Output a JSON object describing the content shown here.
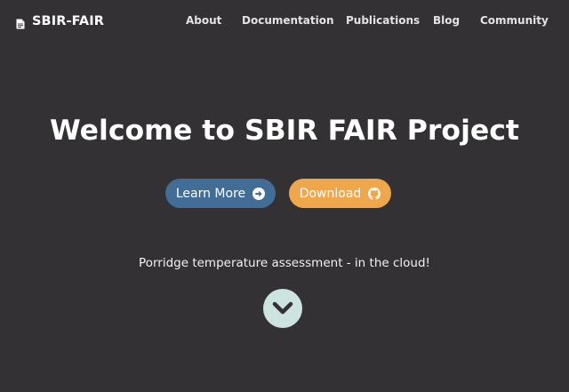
{
  "navbar": {
    "brand": {
      "label": "SBIR-FAIR",
      "icon": "document-icon"
    },
    "links": [
      {
        "label": "About"
      },
      {
        "label": "Documentation"
      },
      {
        "label": "Publications"
      },
      {
        "label": "Blog"
      },
      {
        "label": "Community"
      }
    ]
  },
  "hero": {
    "title": "Welcome to SBIR FAIR Project",
    "buttons": {
      "learn_more": {
        "label": "Learn More",
        "icon": "arrow-circle-right-icon"
      },
      "download": {
        "label": "Download",
        "icon": "github-icon"
      }
    },
    "tagline": "Porridge temperature assessment - in the cloud!",
    "scroll_icon": "chevron-down-icon"
  },
  "colors": {
    "background": "#333134",
    "learn_more_button": "#416d97",
    "download_button": "#f0a74b",
    "scroll_button": "#cde3df"
  }
}
